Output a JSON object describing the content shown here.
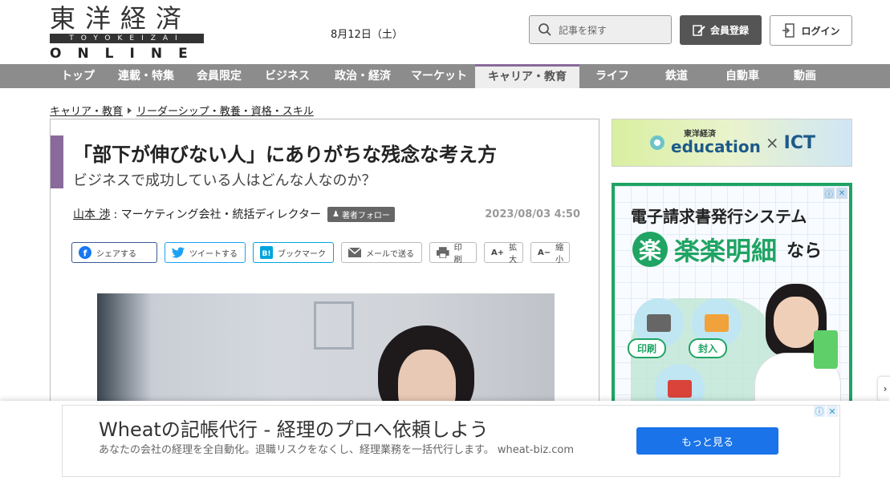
{
  "header": {
    "logo_kanji": "東洋経済",
    "logo_roman": "TOYOKEIZAI",
    "logo_online": "ONLINE",
    "date": "8月12日（土）",
    "search_placeholder": "記事を探す",
    "register_label": "会員登録",
    "login_label": "ログイン"
  },
  "nav": {
    "items": [
      {
        "label": "トップ"
      },
      {
        "label": "連載・特集"
      },
      {
        "label": "会員限定"
      },
      {
        "label": "ビジネス"
      },
      {
        "label": "政治・経済"
      },
      {
        "label": "マーケット"
      },
      {
        "label": "キャリア・教育"
      },
      {
        "label": "ライフ"
      },
      {
        "label": "鉄道"
      },
      {
        "label": "自動車"
      },
      {
        "label": "動画"
      }
    ]
  },
  "breadcrumb": {
    "first": "キャリア・教育",
    "second": "リーダーシップ・教養・資格・スキル"
  },
  "article": {
    "title": "「部下が伸びない人」にありがちな残念な考え方",
    "subtitle": "ビジネスで成功している人はどんな人なのか？",
    "author_name": "山本 渉",
    "author_role": ": マーケティング会社・統括ディレクター",
    "follow_label": "著者フォロー",
    "published": "2023/08/03 4:50",
    "share": {
      "facebook": "シェアする",
      "twitter": "ツイートする",
      "hatena": "ブックマーク",
      "mail": "メールで送る",
      "print": "印刷",
      "zoom_in": "拡大",
      "zoom_out": "縮小"
    }
  },
  "sidebar": {
    "edu_banner_small": "東洋経済",
    "edu_banner_word": "education",
    "edu_banner_x": "×",
    "edu_banner_ict": "ICT",
    "ad_heading": "電子請求書発行システム",
    "ad_raku_icon": "楽",
    "ad_product": "楽楽明細",
    "ad_suffix": "なら",
    "ad_label_print": "印刷",
    "ad_label_envelope": "封入"
  },
  "bottom_ad": {
    "title": "Wheatの記帳代行 - 経理のプロへ依頼しよう",
    "description": "あなたの会社の経理を全自動化。退職リスクをなくし、経理業務を一括代行します。 wheat-biz.com",
    "button": "もっと見る"
  },
  "colors": {
    "nav_bg": "#8c8c8c",
    "accent_purple": "#8a6a9a",
    "ad_green": "#1fa463",
    "cta_blue": "#1a73e8"
  }
}
